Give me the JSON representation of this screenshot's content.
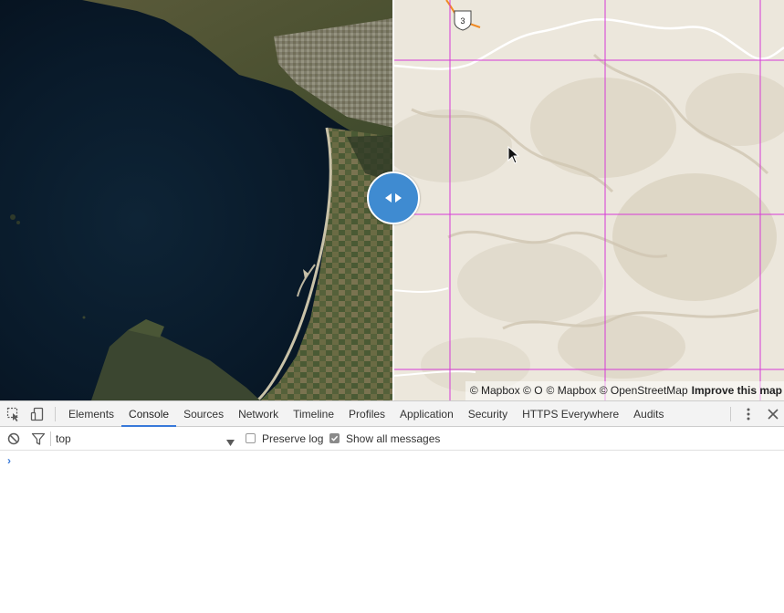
{
  "map": {
    "attribution_left": "© Mapbox © O",
    "attribution_mid": "© Mapbox © OpenStreetMap",
    "attribution_improve": "Improve this map",
    "highway_shield": "3",
    "swipe_handle_icon": "left-right-arrows-icon"
  },
  "devtools": {
    "tabs": [
      {
        "label": "Elements",
        "active": false
      },
      {
        "label": "Console",
        "active": true
      },
      {
        "label": "Sources",
        "active": false
      },
      {
        "label": "Network",
        "active": false
      },
      {
        "label": "Timeline",
        "active": false
      },
      {
        "label": "Profiles",
        "active": false
      },
      {
        "label": "Application",
        "active": false
      },
      {
        "label": "Security",
        "active": false
      },
      {
        "label": "HTTPS Everywhere",
        "active": false
      },
      {
        "label": "Audits",
        "active": false
      }
    ],
    "toolbar": {
      "context": "top",
      "preserve_log_label": "Preserve log",
      "preserve_log_checked": false,
      "show_all_label": "Show all messages",
      "show_all_checked": true
    },
    "console": {
      "prompt": "›"
    },
    "active_tab_color": "#3879d9"
  }
}
